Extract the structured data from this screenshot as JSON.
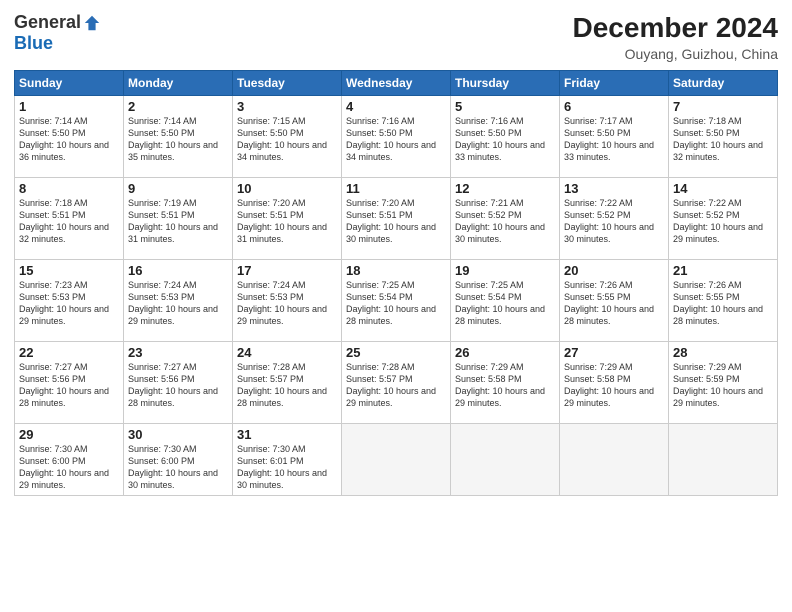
{
  "header": {
    "logo_general": "General",
    "logo_blue": "Blue",
    "title": "December 2024",
    "location": "Ouyang, Guizhou, China"
  },
  "weekdays": [
    "Sunday",
    "Monday",
    "Tuesday",
    "Wednesday",
    "Thursday",
    "Friday",
    "Saturday"
  ],
  "weeks": [
    [
      {
        "day": "1",
        "sunrise": "7:14 AM",
        "sunset": "5:50 PM",
        "daylight": "10 hours and 36 minutes."
      },
      {
        "day": "2",
        "sunrise": "7:14 AM",
        "sunset": "5:50 PM",
        "daylight": "10 hours and 35 minutes."
      },
      {
        "day": "3",
        "sunrise": "7:15 AM",
        "sunset": "5:50 PM",
        "daylight": "10 hours and 34 minutes."
      },
      {
        "day": "4",
        "sunrise": "7:16 AM",
        "sunset": "5:50 PM",
        "daylight": "10 hours and 34 minutes."
      },
      {
        "day": "5",
        "sunrise": "7:16 AM",
        "sunset": "5:50 PM",
        "daylight": "10 hours and 33 minutes."
      },
      {
        "day": "6",
        "sunrise": "7:17 AM",
        "sunset": "5:50 PM",
        "daylight": "10 hours and 33 minutes."
      },
      {
        "day": "7",
        "sunrise": "7:18 AM",
        "sunset": "5:50 PM",
        "daylight": "10 hours and 32 minutes."
      }
    ],
    [
      {
        "day": "8",
        "sunrise": "7:18 AM",
        "sunset": "5:51 PM",
        "daylight": "10 hours and 32 minutes."
      },
      {
        "day": "9",
        "sunrise": "7:19 AM",
        "sunset": "5:51 PM",
        "daylight": "10 hours and 31 minutes."
      },
      {
        "day": "10",
        "sunrise": "7:20 AM",
        "sunset": "5:51 PM",
        "daylight": "10 hours and 31 minutes."
      },
      {
        "day": "11",
        "sunrise": "7:20 AM",
        "sunset": "5:51 PM",
        "daylight": "10 hours and 30 minutes."
      },
      {
        "day": "12",
        "sunrise": "7:21 AM",
        "sunset": "5:52 PM",
        "daylight": "10 hours and 30 minutes."
      },
      {
        "day": "13",
        "sunrise": "7:22 AM",
        "sunset": "5:52 PM",
        "daylight": "10 hours and 30 minutes."
      },
      {
        "day": "14",
        "sunrise": "7:22 AM",
        "sunset": "5:52 PM",
        "daylight": "10 hours and 29 minutes."
      }
    ],
    [
      {
        "day": "15",
        "sunrise": "7:23 AM",
        "sunset": "5:53 PM",
        "daylight": "10 hours and 29 minutes."
      },
      {
        "day": "16",
        "sunrise": "7:24 AM",
        "sunset": "5:53 PM",
        "daylight": "10 hours and 29 minutes."
      },
      {
        "day": "17",
        "sunrise": "7:24 AM",
        "sunset": "5:53 PM",
        "daylight": "10 hours and 29 minutes."
      },
      {
        "day": "18",
        "sunrise": "7:25 AM",
        "sunset": "5:54 PM",
        "daylight": "10 hours and 28 minutes."
      },
      {
        "day": "19",
        "sunrise": "7:25 AM",
        "sunset": "5:54 PM",
        "daylight": "10 hours and 28 minutes."
      },
      {
        "day": "20",
        "sunrise": "7:26 AM",
        "sunset": "5:55 PM",
        "daylight": "10 hours and 28 minutes."
      },
      {
        "day": "21",
        "sunrise": "7:26 AM",
        "sunset": "5:55 PM",
        "daylight": "10 hours and 28 minutes."
      }
    ],
    [
      {
        "day": "22",
        "sunrise": "7:27 AM",
        "sunset": "5:56 PM",
        "daylight": "10 hours and 28 minutes."
      },
      {
        "day": "23",
        "sunrise": "7:27 AM",
        "sunset": "5:56 PM",
        "daylight": "10 hours and 28 minutes."
      },
      {
        "day": "24",
        "sunrise": "7:28 AM",
        "sunset": "5:57 PM",
        "daylight": "10 hours and 28 minutes."
      },
      {
        "day": "25",
        "sunrise": "7:28 AM",
        "sunset": "5:57 PM",
        "daylight": "10 hours and 29 minutes."
      },
      {
        "day": "26",
        "sunrise": "7:29 AM",
        "sunset": "5:58 PM",
        "daylight": "10 hours and 29 minutes."
      },
      {
        "day": "27",
        "sunrise": "7:29 AM",
        "sunset": "5:58 PM",
        "daylight": "10 hours and 29 minutes."
      },
      {
        "day": "28",
        "sunrise": "7:29 AM",
        "sunset": "5:59 PM",
        "daylight": "10 hours and 29 minutes."
      }
    ],
    [
      {
        "day": "29",
        "sunrise": "7:30 AM",
        "sunset": "6:00 PM",
        "daylight": "10 hours and 29 minutes."
      },
      {
        "day": "30",
        "sunrise": "7:30 AM",
        "sunset": "6:00 PM",
        "daylight": "10 hours and 30 minutes."
      },
      {
        "day": "31",
        "sunrise": "7:30 AM",
        "sunset": "6:01 PM",
        "daylight": "10 hours and 30 minutes."
      },
      null,
      null,
      null,
      null
    ]
  ]
}
